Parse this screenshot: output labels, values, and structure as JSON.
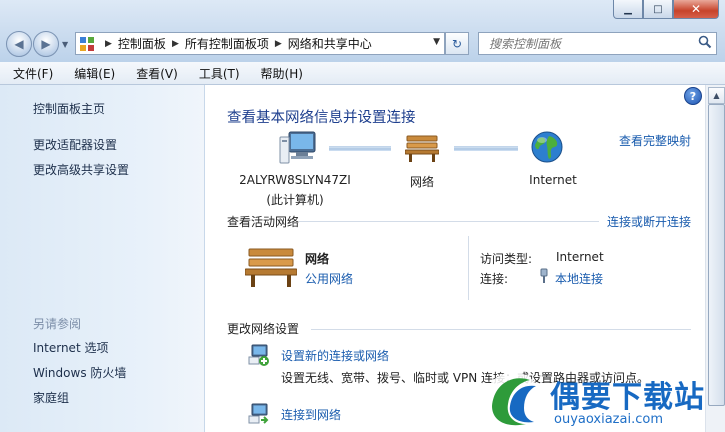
{
  "window": {
    "minimize_icon": "minimize-icon",
    "maximize_icon": "maximize-icon",
    "close_icon": "close-icon"
  },
  "address": {
    "crumbs": [
      "控制面板",
      "所有控制面板项",
      "网络和共享中心"
    ]
  },
  "search": {
    "placeholder": "搜索控制面板"
  },
  "menu": [
    "文件(F)",
    "编辑(E)",
    "查看(V)",
    "工具(T)",
    "帮助(H)"
  ],
  "sidebar": {
    "links": [
      "控制面板主页",
      "更改适配器设置",
      "更改高级共享设置"
    ],
    "see_also_title": "另请参阅",
    "see_also": [
      "Internet 选项",
      "Windows 防火墙",
      "家庭组"
    ]
  },
  "main": {
    "title": "查看基本网络信息并设置连接",
    "full_map_link": "查看完整映射",
    "nodes": {
      "computer_name": "2ALYRW8SLYN47ZI",
      "computer_sub": "(此计算机)",
      "network": "网络",
      "internet": "Internet"
    },
    "active": {
      "heading": "查看活动网络",
      "connect_link": "连接或断开连接",
      "network_name": "网络",
      "network_type": "公用网络",
      "access_label": "访问类型:",
      "access_value": "Internet",
      "conn_label": "连接:",
      "conn_value": "本地连接"
    },
    "change": {
      "heading": "更改网络设置",
      "items": [
        {
          "title": "设置新的连接或网络",
          "desc": "设置无线、宽带、拨号、临时或 VPN 连接；或设置路由器或访问点。"
        },
        {
          "title": "连接到网络",
          "desc": ""
        }
      ]
    }
  },
  "watermark": {
    "brand": "偶要下载站",
    "url": "ouyaoxiazai.com"
  },
  "colors": {
    "link": "#1a5cae",
    "title": "#1e3f8e",
    "accent": "#1769c2"
  }
}
